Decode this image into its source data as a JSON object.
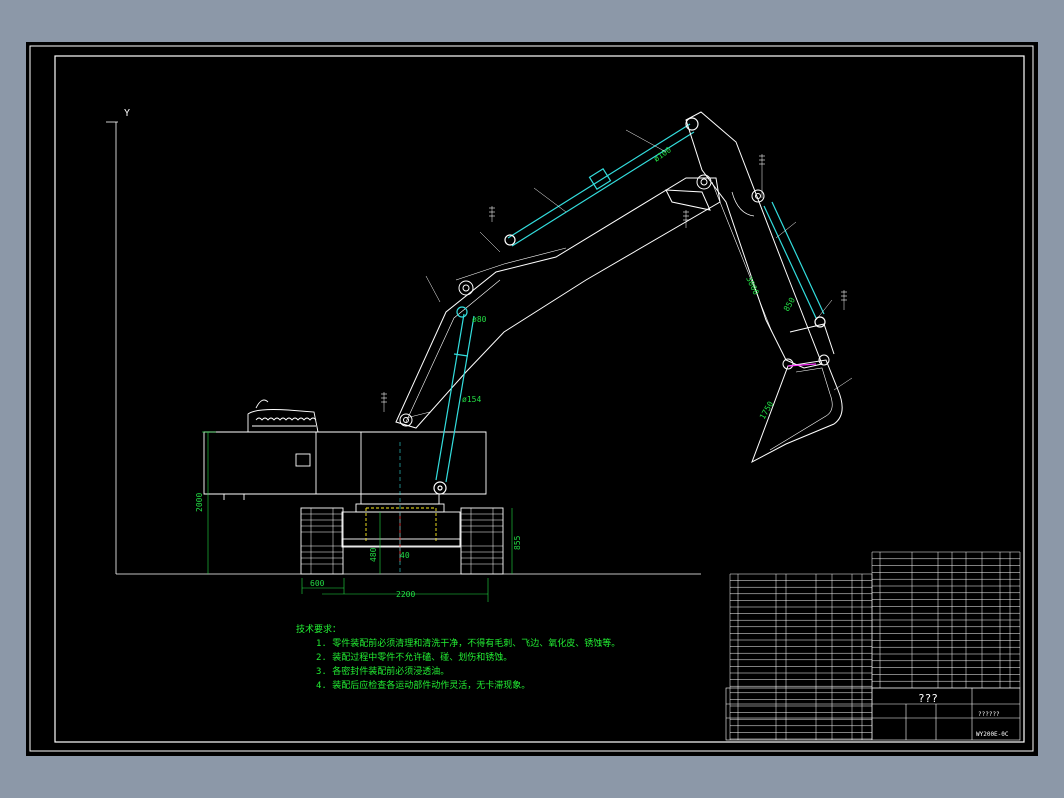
{
  "drawing": {
    "axis_y_label": "Y",
    "dimensions": {
      "height_2000": "2000",
      "track_600": "600",
      "width_2200": "2200",
      "gap_480": "480",
      "gap_40": "40",
      "track_855": "855",
      "cyl_154": "ø154",
      "cyl_80": "ø80",
      "boom_100": "ø100",
      "arm_3000": "3000",
      "arm_850": "850",
      "bucket_1750": "1750"
    },
    "notes": {
      "heading": "技术要求：",
      "lines": [
        "1. 零件装配前必须清理和清洗干净，不得有毛刺、飞边、氧化皮、锈蚀等。",
        "2. 装配过程中零件不允许磕、碰、划伤和锈蚀。",
        "3. 各密封件装配前必须浸透油。",
        "4. 装配后应检查各运动部件动作灵活，无卡滞现象。"
      ]
    },
    "title_block": {
      "title": "???",
      "drawing_number": "WY200E-0C",
      "code": "??????"
    }
  },
  "colors": {
    "background": "#8c98a8",
    "sheet": "#000000",
    "line": "#ffffff",
    "dimension": "#22dd44",
    "cylinder": "#33dddd",
    "hidden": "#ffee22",
    "accent": "#ff33ff"
  }
}
